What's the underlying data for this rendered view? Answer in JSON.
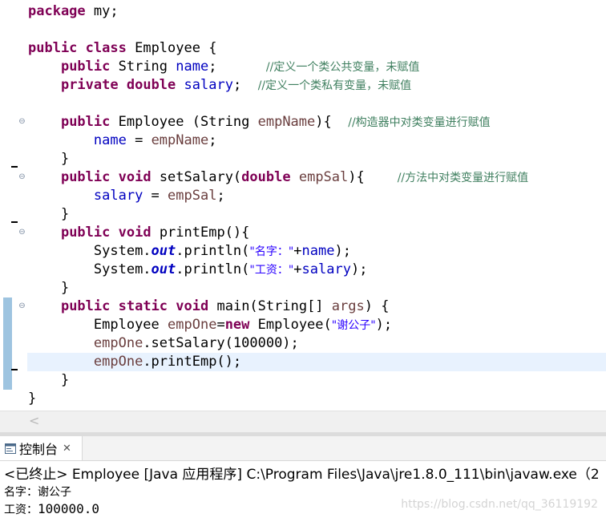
{
  "editor": {
    "package_kw": "package",
    "package_rest": " my;",
    "class_decl": {
      "k1": "public",
      "k2": "class",
      "rest": " Employee {"
    },
    "field_name": {
      "k1": "public",
      "type": " String ",
      "ident": "name",
      "semi": ";",
      "comment": "//定义一个类公共变量，未赋值"
    },
    "field_salary": {
      "k1": "private",
      "k2": "double",
      "ident": "salary",
      "semi": ";",
      "comment": "//定义一个类私有变量，未赋值"
    },
    "ctor": {
      "k1": "public",
      "sig": " Employee (String ",
      "param": "empName",
      "rest": "){",
      "comment": "//构造器中对类变量进行赋值"
    },
    "ctor_body": {
      "lhs": "name",
      "eq": " = ",
      "rhs": "empName",
      "semi": ";"
    },
    "close_brace": "}",
    "set_salary": {
      "k1": "public",
      "k2": "void",
      "name": " setSalary(",
      "k3": "double",
      "param": "empSal",
      "rest": "){",
      "comment": "//方法中对类变量进行赋值"
    },
    "set_body": {
      "lhs": "salary",
      "eq": " = ",
      "rhs": "empSal",
      "semi": ";"
    },
    "print_emp": {
      "k1": "public",
      "k2": "void",
      "rest": " printEmp(){"
    },
    "println1": {
      "pre": "System.",
      "out": "out",
      "call": ".println(",
      "str": "\"名字：\"",
      "plus": "+",
      "fld": "name",
      "end": ");"
    },
    "println2": {
      "pre": "System.",
      "out": "out",
      "call": ".println(",
      "str": "\"工资：\"",
      "plus": "+",
      "fld": "salary",
      "end": ");"
    },
    "main_decl": {
      "k1": "public",
      "k2": "static",
      "k3": "void",
      "mid": " main(String[] ",
      "param": "args",
      "rest": ") {"
    },
    "main_l1": {
      "type": "Employee ",
      "var": "empOne",
      "eq": "=",
      "kw": "new",
      "ctor": " Employee(",
      "str": "\"谢公子\"",
      "end": ");"
    },
    "main_l2": {
      "var": "empOne",
      "call": ".setSalary(100000);"
    },
    "main_l3": {
      "var": "empOne",
      "call": ".printEmp();"
    }
  },
  "console": {
    "tab_label": "控制台",
    "tab_close": "✕",
    "header": "<已终止> Employee [Java 应用程序] C:\\Program Files\\Java\\jre1.8.0_111\\bin\\javaw.exe（2",
    "output": [
      {
        "label": "名字：",
        "value": "谢公子"
      },
      {
        "label": "工资：",
        "value": "100000.0"
      }
    ],
    "watermark": "https://blog.csdn.net/qq_36119192"
  },
  "icons": {
    "fold": "collapse-icon",
    "console": "console-icon",
    "scroll_left": "scroll-left-icon"
  }
}
